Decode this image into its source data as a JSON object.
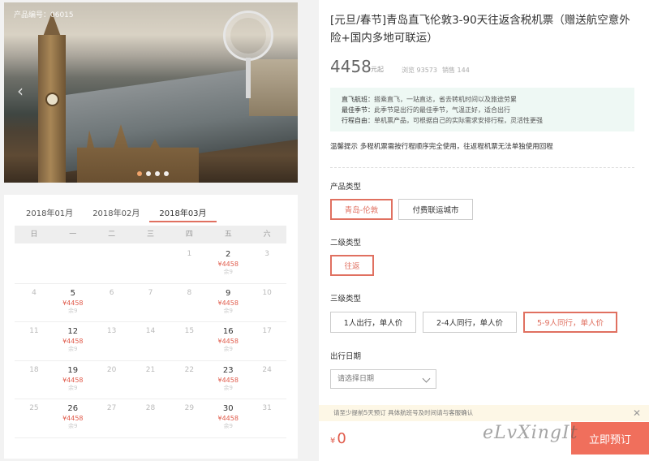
{
  "gallery": {
    "code": "产品编号：06015",
    "prev_icon": "‹",
    "dots": 4,
    "active_dot": 0
  },
  "calendar": {
    "tabs": [
      "2018年01月",
      "2018年02月",
      "2018年03月"
    ],
    "active_tab": 2,
    "weekdays": [
      "日",
      "一",
      "二",
      "三",
      "四",
      "五",
      "六"
    ],
    "weeks": [
      [
        {
          "d": ""
        },
        {
          "d": ""
        },
        {
          "d": ""
        },
        {
          "d": ""
        },
        {
          "d": "1"
        },
        {
          "d": "2",
          "price": "¥4458",
          "rem": "余9"
        },
        {
          "d": "3"
        }
      ],
      [
        {
          "d": "4"
        },
        {
          "d": "5",
          "price": "¥4458",
          "rem": "余9"
        },
        {
          "d": "6"
        },
        {
          "d": "7"
        },
        {
          "d": "8"
        },
        {
          "d": "9",
          "price": "¥4458",
          "rem": "余9"
        },
        {
          "d": "10"
        }
      ],
      [
        {
          "d": "11"
        },
        {
          "d": "12",
          "price": "¥4458",
          "rem": "余9"
        },
        {
          "d": "13"
        },
        {
          "d": "14"
        },
        {
          "d": "15"
        },
        {
          "d": "16",
          "price": "¥4458",
          "rem": "余9"
        },
        {
          "d": "17"
        }
      ],
      [
        {
          "d": "18"
        },
        {
          "d": "19",
          "price": "¥4458",
          "rem": "余9"
        },
        {
          "d": "20"
        },
        {
          "d": "21"
        },
        {
          "d": "22"
        },
        {
          "d": "23",
          "price": "¥4458",
          "rem": "余9"
        },
        {
          "d": "24"
        }
      ],
      [
        {
          "d": "25"
        },
        {
          "d": "26",
          "price": "¥4458",
          "rem": "余9"
        },
        {
          "d": "27"
        },
        {
          "d": "28"
        },
        {
          "d": "29"
        },
        {
          "d": "30",
          "price": "¥4458",
          "rem": "余9"
        },
        {
          "d": "31"
        }
      ]
    ]
  },
  "product": {
    "title": "[元旦/春节]青岛直飞伦敦3-90天往返含税机票（赠送航空意外险+国内多地可联运）",
    "price": "4458",
    "price_unit": "元起",
    "views": "浏览 93573",
    "sales": "销售 144",
    "features": [
      {
        "k": "直飞航班：",
        "v": "搭乘直飞，一站直达，省去转机时间以及旅途劳累"
      },
      {
        "k": "最佳季节：",
        "v": "此季节是出行的最佳季节，气温正好，适合出行"
      },
      {
        "k": "行程自由：",
        "v": "单机票产品，可根据自己的实际需求安排行程，灵活性更强"
      }
    ],
    "tip": "温馨提示   多程机票需按行程顺序完全使用，往返程机票无法单独使用回程"
  },
  "options": {
    "type_label": "产品类型",
    "types": [
      "青岛-伦敦",
      "付费联运城市"
    ],
    "type_selected": 0,
    "level2_label": "二级类型",
    "level2": [
      "往返"
    ],
    "level2_selected": 0,
    "level3_label": "三级类型",
    "level3": [
      "1人出行，单人价",
      "2-4人同行，单人价",
      "5-9人同行，单人价"
    ],
    "level3_selected": 2,
    "date_label": "出行日期",
    "date_placeholder": "请选择日期"
  },
  "footer": {
    "notice": "请至少提前5天预订 具体航班号及时间请与客服确认",
    "close_icon": "✕",
    "currency": "¥",
    "total": "0",
    "book_label": "立即预订",
    "watermark": "eLvXingIt"
  },
  "colors": {
    "accent": "#e07060",
    "price": "#e05a4a",
    "info_bg": "#eef8f4",
    "notice_bg": "#fdf7e6"
  }
}
